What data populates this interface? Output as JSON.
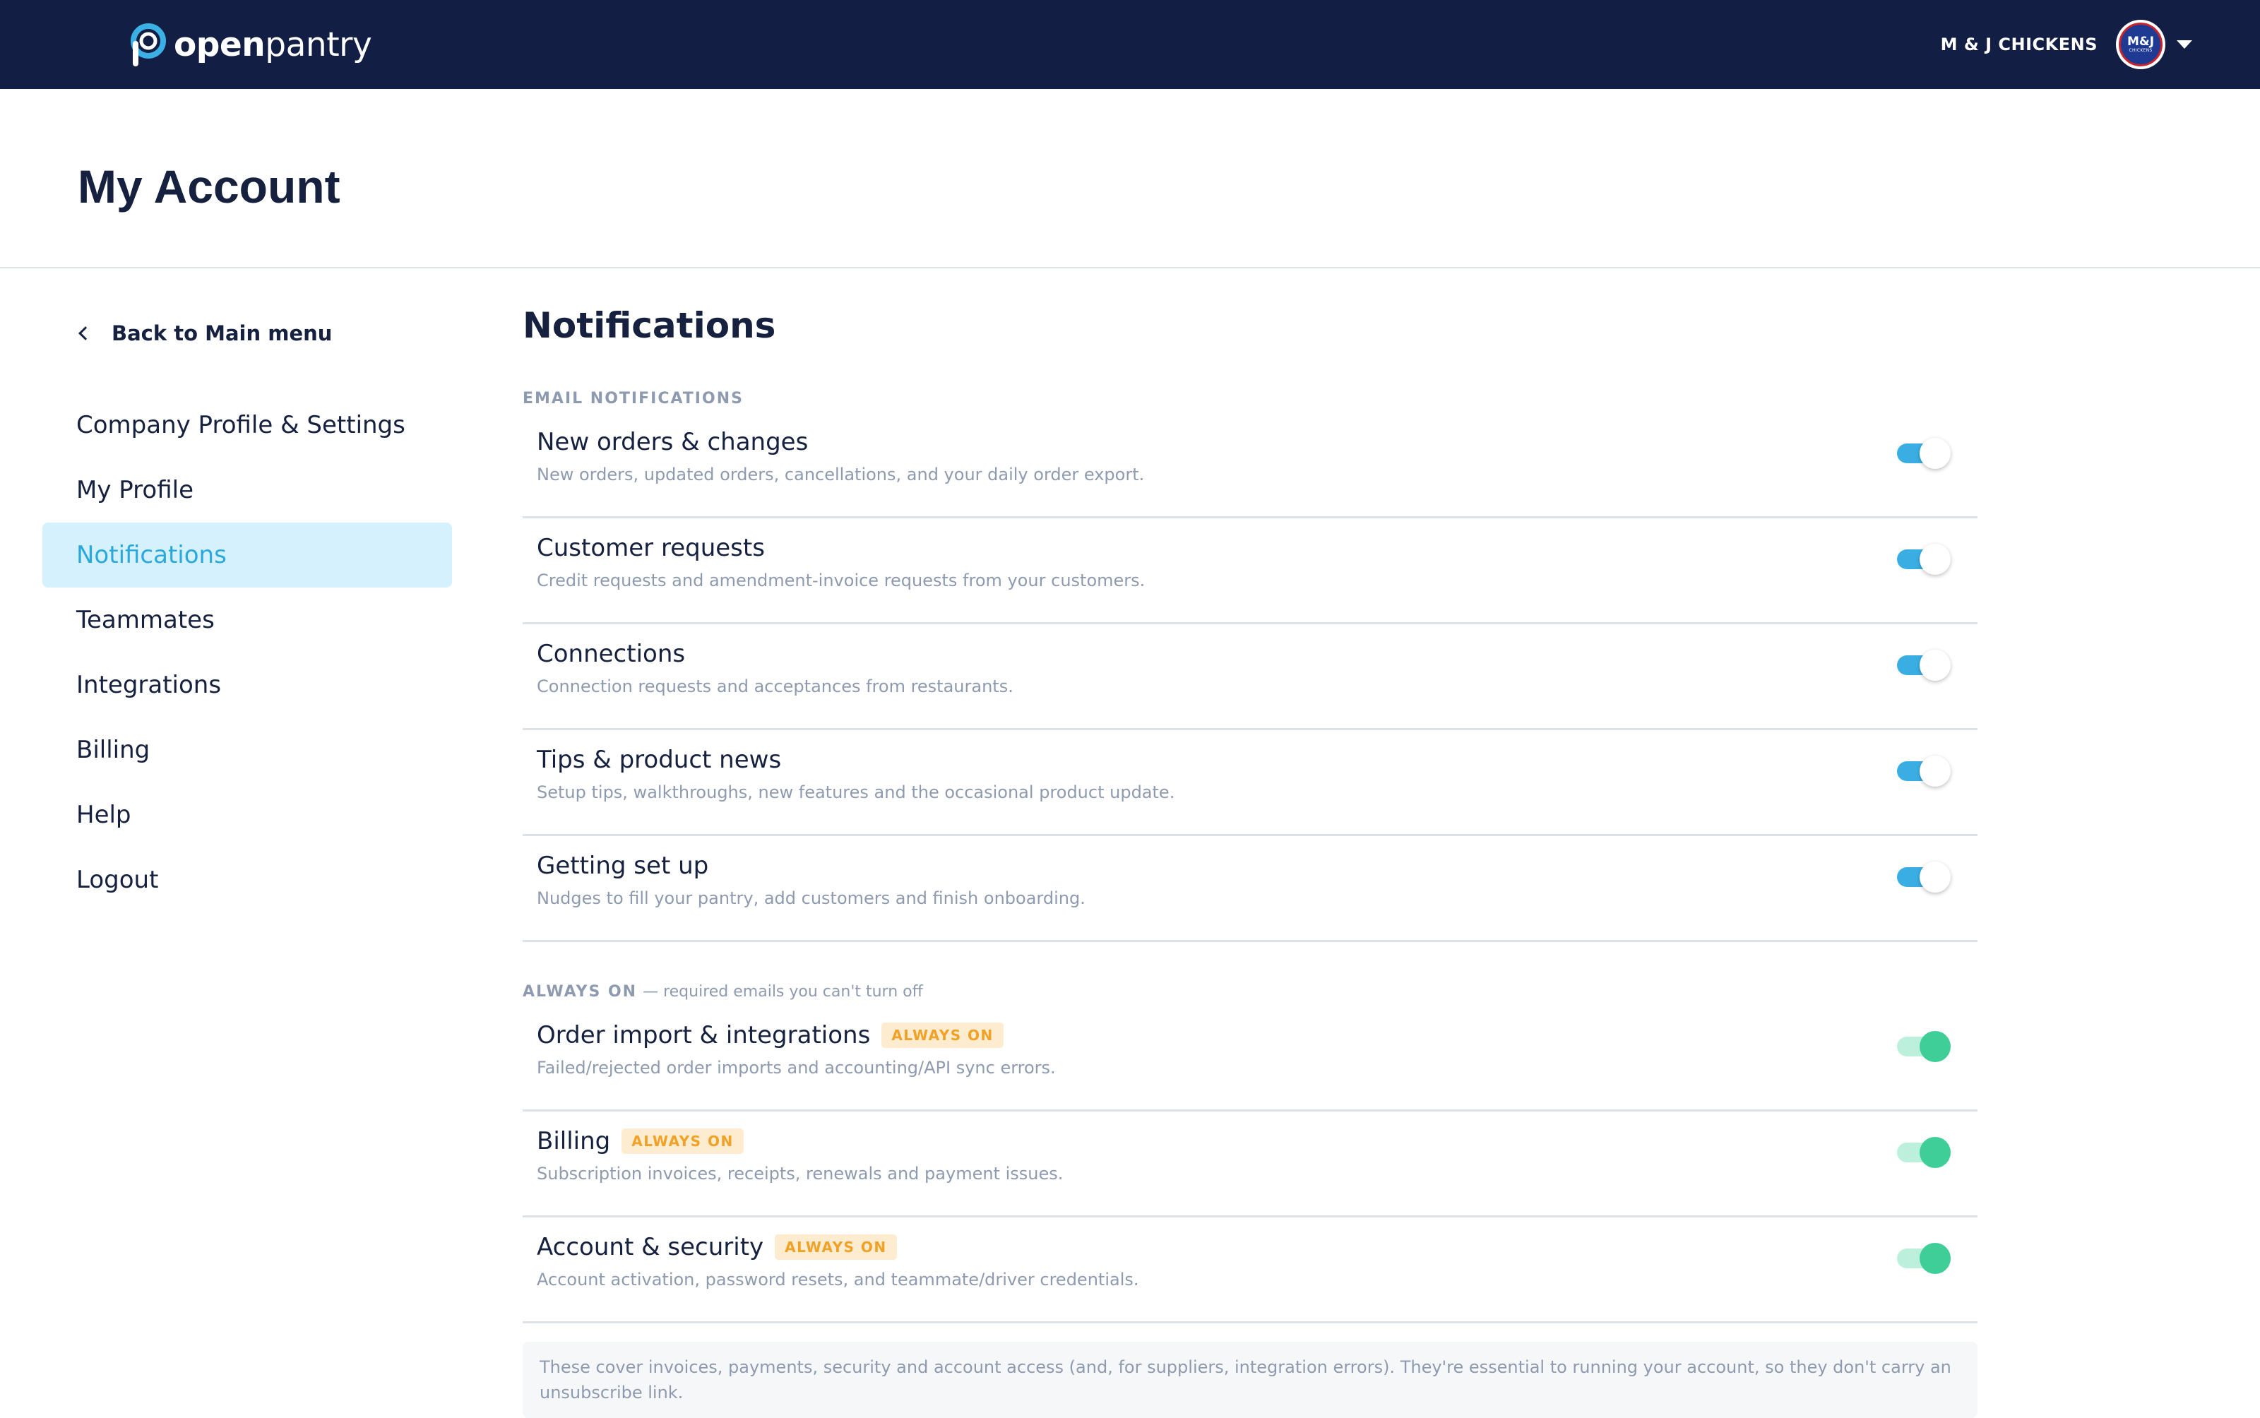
{
  "app": {
    "logo_bold": "open",
    "logo_light": "pantry",
    "company_name": "M & J CHICKENS",
    "avatar_text": "M&J",
    "avatar_subtext": "CHICKENS"
  },
  "page": {
    "title": "My Account"
  },
  "sidebar": {
    "back_label": "Back to Main menu",
    "items": [
      {
        "label": "Company Profile & Settings"
      },
      {
        "label": "My Profile"
      },
      {
        "label": "Notifications",
        "active": true
      },
      {
        "label": "Teammates"
      },
      {
        "label": "Integrations"
      },
      {
        "label": "Billing"
      },
      {
        "label": "Help"
      },
      {
        "label": "Logout"
      }
    ]
  },
  "notifications": {
    "title": "Notifications",
    "email_group": {
      "label": "EMAIL NOTIFICATIONS",
      "rows": [
        {
          "title": "New orders & changes",
          "desc": "New orders, updated orders, cancellations, and your daily order export.",
          "enabled": true
        },
        {
          "title": "Customer requests",
          "desc": "Credit requests and amendment-invoice requests from your customers.",
          "enabled": true
        },
        {
          "title": "Connections",
          "desc": "Connection requests and acceptances from restaurants.",
          "enabled": true
        },
        {
          "title": "Tips & product news",
          "desc": "Setup tips, walkthroughs, new features and the occasional product update.",
          "enabled": true
        },
        {
          "title": "Getting set up",
          "desc": "Nudges to fill your pantry, add customers and finish onboarding.",
          "enabled": true
        }
      ]
    },
    "always_group": {
      "label": "ALWAYS ON",
      "sublabel": "— required emails you can't turn off",
      "badge": "ALWAYS ON",
      "rows": [
        {
          "title": "Order import & integrations",
          "desc": "Failed/rejected order imports and accounting/API sync errors.",
          "enabled": true
        },
        {
          "title": "Billing",
          "desc": "Subscription invoices, receipts, renewals and payment issues.",
          "enabled": true
        },
        {
          "title": "Account & security",
          "desc": "Account activation, password resets, and teammate/driver credentials.",
          "enabled": true
        }
      ]
    },
    "note": "These cover invoices, payments, security and account access (and, for suppliers, integration errors). They're essential to running your account, so they don't carry an unsubscribe link."
  },
  "colors": {
    "topbar": "#131e45",
    "accent": "#2aa8dc",
    "toggle_on": "#3aaee3",
    "toggle_locked": "#3fce97",
    "badge_text": "#f0a126"
  }
}
